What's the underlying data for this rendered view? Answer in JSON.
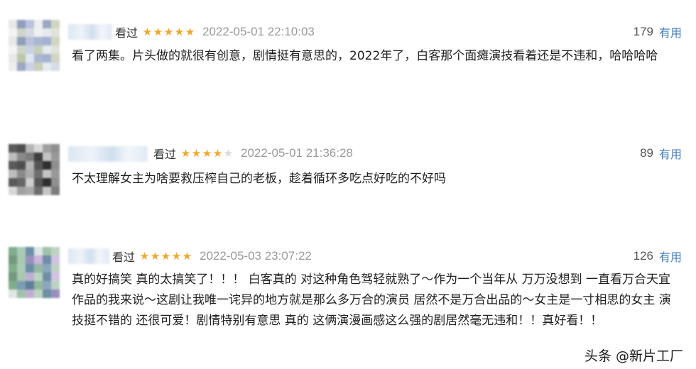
{
  "reviews": [
    {
      "status": "看过",
      "stars": 5,
      "time": "2022-05-01 22:10:03",
      "votes": "179",
      "useful": "有用",
      "content": "看了两集。片头做的就很有创意，剧情挺有意思的，2022年了，白客那个面瘫演技看着还是不违和，哈哈哈哈"
    },
    {
      "status": "看过",
      "stars": 4,
      "time": "2022-05-01 21:36:28",
      "votes": "89",
      "useful": "有用",
      "content": "不太理解女主为啥要救压榨自己的老板，趁着循环多吃点好吃的不好吗"
    },
    {
      "status": "看过",
      "stars": 5,
      "time": "2022-05-03 23:07:22",
      "votes": "126",
      "useful": "有用",
      "content": "真的好搞笑 真的太搞笑了！！！ 白客真的 对这种角色驾轻就熟了～作为一个当年从 万万没想到 一直看万合天宜作品的我来说～这剧让我唯一诧异的地方就是那么多万合的演员 居然不是万合出品的～女主是一寸相思的女主 演技挺不错的 还很可爱！剧情特别有意思 真的 这俩演漫画感这么强的剧居然毫无违和！！真好看！！"
    }
  ],
  "watermark": "头条 @新片工厂",
  "colors": {
    "star_on": "#f5a623",
    "star_off": "#d8d8d8",
    "useful_link": "#3b7dc4",
    "time": "#9a9a9a"
  }
}
